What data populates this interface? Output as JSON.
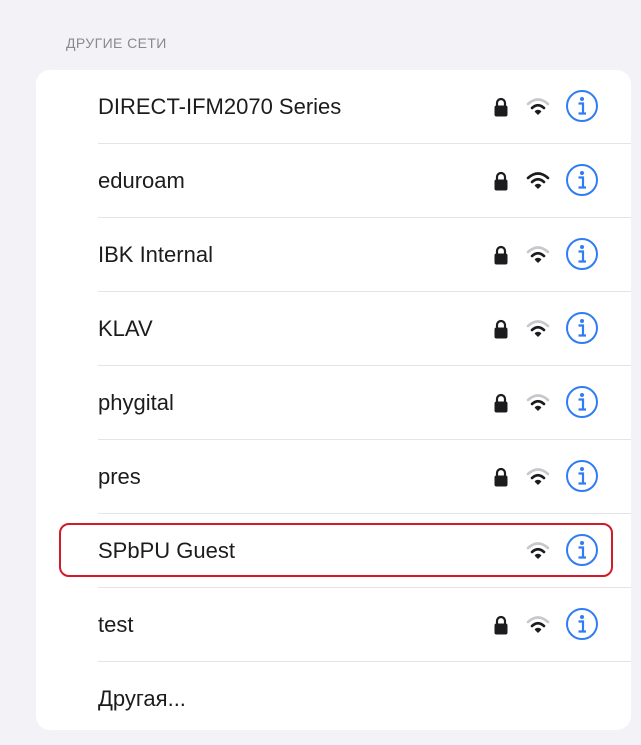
{
  "section": {
    "title": "ДРУГИЕ СЕТИ"
  },
  "networks": [
    {
      "name": "DIRECT-IFM2070 Series",
      "locked": true,
      "signal": "medium"
    },
    {
      "name": "eduroam",
      "locked": true,
      "signal": "strong"
    },
    {
      "name": "IBK Internal",
      "locked": true,
      "signal": "medium"
    },
    {
      "name": "KLAV",
      "locked": true,
      "signal": "medium"
    },
    {
      "name": "phygital",
      "locked": true,
      "signal": "medium"
    },
    {
      "name": "pres",
      "locked": true,
      "signal": "medium"
    },
    {
      "name": "SPbPU Guest",
      "locked": false,
      "signal": "medium",
      "highlighted": true
    },
    {
      "name": "test",
      "locked": true,
      "signal": "medium"
    }
  ],
  "other": {
    "label": "Другая..."
  },
  "icons": {
    "lock": "lock-icon",
    "wifi": "wifi-icon",
    "info": "info-icon"
  },
  "colors": {
    "accent": "#2f7cf6",
    "highlight": "#d11a2a",
    "text": "#1c1c1e",
    "secondary": "#8a8a8e",
    "background": "#f2f2f7"
  }
}
